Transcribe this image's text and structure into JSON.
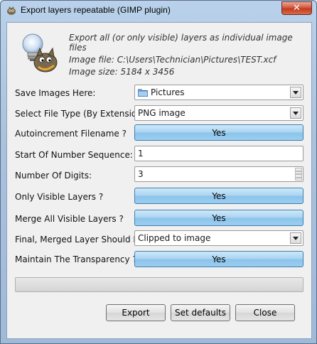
{
  "window": {
    "title": "Export layers repeatable (GIMP plugin)",
    "close_glyph": "✕"
  },
  "header": {
    "description": "Export all (or only visible) layers as individual image files",
    "image_file": "Image file:  C:\\Users\\Technician\\Pictures\\TEST.xcf",
    "image_size": "Image size:  5184 x 3456"
  },
  "form": {
    "save_images": {
      "label": "Save Images Here:",
      "value": "Pictures"
    },
    "file_type": {
      "label": "Select File Type (By Extension):",
      "value": "PNG image"
    },
    "autoincrement": {
      "label": "Autoincrement Filename ?",
      "value": "Yes"
    },
    "start_number": {
      "label": "Start Of Number Sequence:",
      "value": "1"
    },
    "num_digits": {
      "label": "Number Of Digits:",
      "value": "3"
    },
    "only_visible": {
      "label": "Only Visible Layers ?",
      "value": "Yes"
    },
    "merge_visible": {
      "label": "Merge All Visible Layers ?",
      "value": "Yes"
    },
    "final_layer": {
      "label": "Final, Merged Layer Should Be:",
      "value": "Clipped to image"
    },
    "transparency": {
      "label": "Maintain The Transparency ?",
      "value": "Yes"
    }
  },
  "progress": {
    "fraction": 0
  },
  "buttons": {
    "export": "Export",
    "set_defaults": "Set defaults",
    "close": "Close"
  },
  "colors": {
    "toggle_blue": "#a9d4f2",
    "titlebar": "#b9d1ea",
    "close_red": "#c23c1e"
  }
}
